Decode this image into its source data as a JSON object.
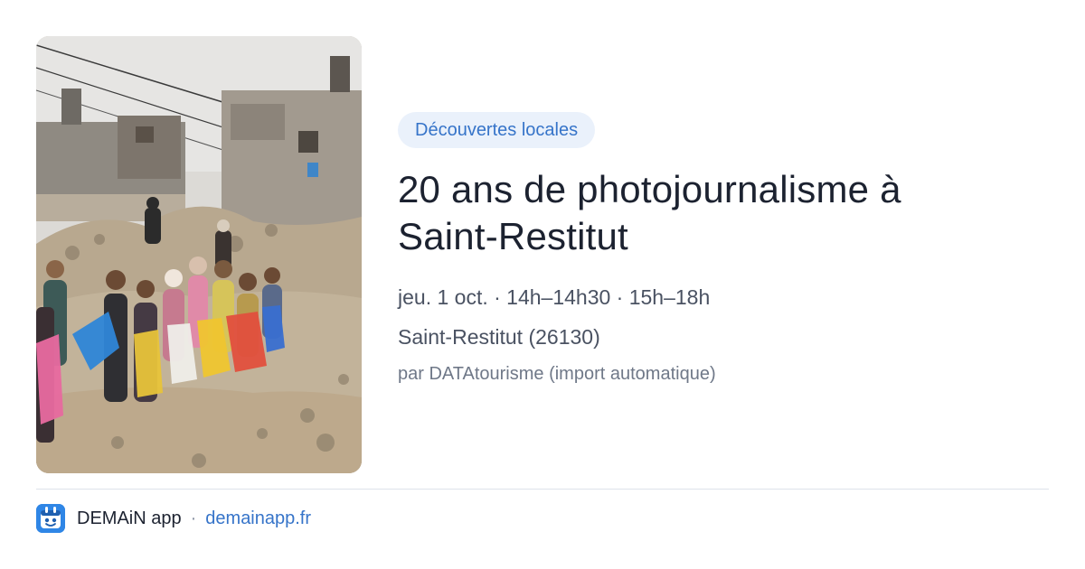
{
  "event": {
    "category": "Découvertes locales",
    "title_line1": "20 ans de photojournalisme à",
    "title_line2": "Saint-Restitut",
    "datetime": "jeu. 1 oct. · 14h–14h30 · 15h–18h",
    "location": "Saint-Restitut (26130)",
    "source": "par DATAtourisme (import automatique)"
  },
  "footer": {
    "app_name": "DEMAiN app",
    "separator": "·",
    "domain": "demainapp.fr"
  },
  "colors": {
    "accent": "#3674c9",
    "tag_bg": "#eaf1fb",
    "title": "#1c2230",
    "muted": "#6f7888",
    "app_icon_bg": "#2f86e6"
  },
  "icons": {
    "app_icon": "demain-app-icon"
  }
}
